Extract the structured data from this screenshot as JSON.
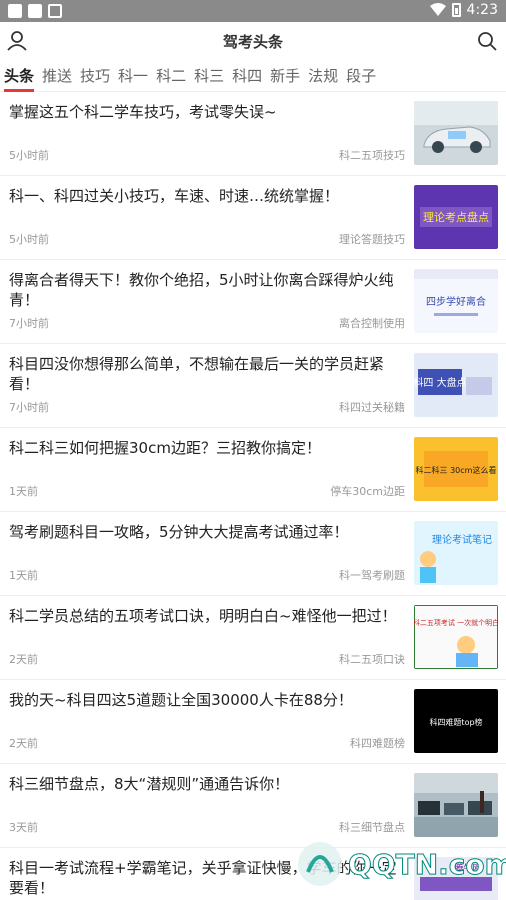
{
  "status_bar": {
    "time": "4:23"
  },
  "header": {
    "title": "驾考头条"
  },
  "tabs": [
    "头条",
    "推送",
    "技巧",
    "科一",
    "科二",
    "科三",
    "科四",
    "新手",
    "法规",
    "段子"
  ],
  "articles": [
    {
      "title": "掌握这五个科二学车技巧，考试零失误~",
      "time": "5小时前",
      "tag": "科二五项技巧",
      "thumb_text": ""
    },
    {
      "title": "科一、科四过关小技巧，车速、时速…统统掌握！",
      "time": "5小时前",
      "tag": "理论答题技巧",
      "thumb_text": "理论考点盘点"
    },
    {
      "title": "得离合者得天下！教你个绝招，5小时让你离合踩得炉火纯青！",
      "time": "7小时前",
      "tag": "离合控制使用",
      "thumb_text": "四步学好离合"
    },
    {
      "title": "科目四没你想得那么简单，不想输在最后一关的学员赶紧看！",
      "time": "7小时前",
      "tag": "科四过关秘籍",
      "thumb_text": "科四 大盘点"
    },
    {
      "title": "科二科三如何把握30cm边距？三招教你搞定！",
      "time": "1天前",
      "tag": "停车30cm边距",
      "thumb_text": "科二科三 30cm这么看"
    },
    {
      "title": "驾考刷题科目一攻略，5分钟大大提高考试通过率！",
      "time": "1天前",
      "tag": "科一驾考刷题",
      "thumb_text": "理论考试笔记"
    },
    {
      "title": "科二学员总结的五项考试口诀，明明白白~难怪他一把过！",
      "time": "2天前",
      "tag": "科二五项口诀",
      "thumb_text": "科二五项考试 一次就个明白"
    },
    {
      "title": "我的天~科目四这5道题让全国30000人卡在88分！",
      "time": "2天前",
      "tag": "科四难题榜",
      "thumb_text": "科四难题top榜"
    },
    {
      "title": "科三细节盘点，8大“潜规则”通通告诉你！",
      "time": "3天前",
      "tag": "科三细节盘点",
      "thumb_text": ""
    },
    {
      "title": "科目一考试流程+学霸笔记，关乎拿证快慢，学车的你一定要看！",
      "time": "",
      "tag": "",
      "thumb_text": "腾牛网"
    }
  ],
  "watermark": {
    "text": "QQTN.com"
  },
  "colors": {
    "accent": "#e53935",
    "status_bar": "#8a8a8a"
  }
}
